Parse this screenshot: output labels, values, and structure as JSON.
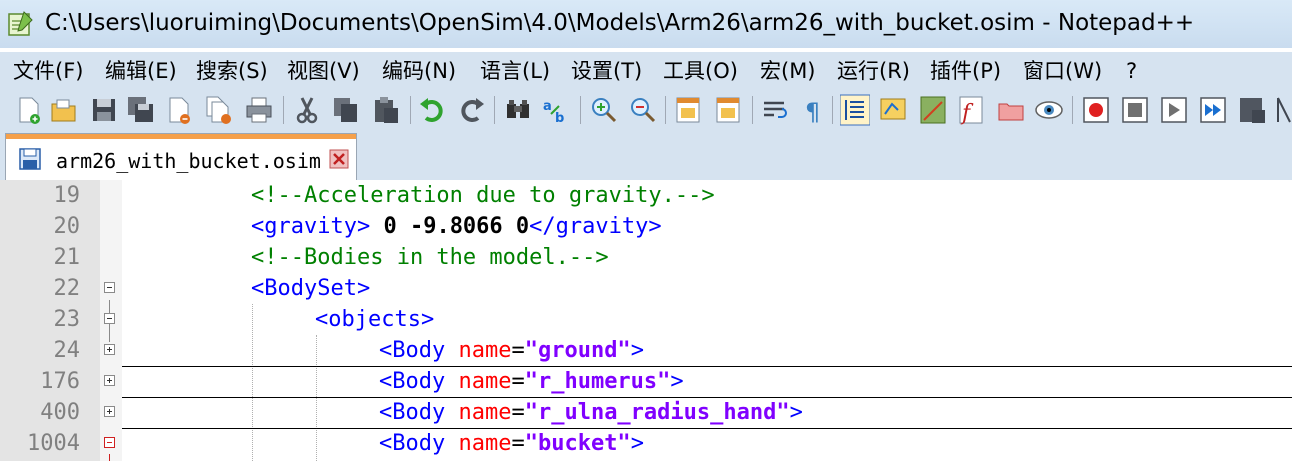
{
  "window": {
    "title": "C:\\Users\\luoruiming\\Documents\\OpenSim\\4.0\\Models\\Arm26\\arm26_with_bucket.osim - Notepad++"
  },
  "menu": [
    "文件(F)",
    "编辑(E)",
    "搜索(S)",
    "视图(V)",
    "编码(N)",
    "语言(L)",
    "设置(T)",
    "工具(O)",
    "宏(M)",
    "运行(R)",
    "插件(P)",
    "窗口(W)",
    "?"
  ],
  "toolbar": {
    "buttons": [
      "new-file-icon",
      "open-file-icon",
      "save-icon",
      "save-all-icon",
      "close-icon",
      "close-all-icon",
      "print-icon",
      "cut-icon",
      "copy-icon",
      "paste-icon",
      "undo-icon",
      "redo-icon",
      "find-icon",
      "replace-icon",
      "zoom-in-icon",
      "zoom-out-icon",
      "sync-vertical-icon",
      "sync-horizontal-icon",
      "word-wrap-icon",
      "show-all-characters-icon",
      "indent-guide-icon",
      "language-icon",
      "document-map-icon",
      "function-list-icon",
      "folder-as-workspace-icon",
      "monitoring-icon",
      "record-macro-icon",
      "stop-recording-icon",
      "play-macro-icon",
      "run-macro-multiple-icon",
      "save-macro-icon",
      "more-icon"
    ]
  },
  "tabs": [
    {
      "label": "arm26_with_bucket.osim"
    }
  ],
  "editor": {
    "lines": [
      {
        "num": "19",
        "fold": "",
        "indent": 8,
        "comment": "<!--Acceleration due to gravity.-->"
      },
      {
        "num": "20",
        "fold": "",
        "indent": 8,
        "tag_open": "<gravity>",
        "value": " 0 -9.8066 0",
        "tag_close": "</gravity>"
      },
      {
        "num": "21",
        "fold": "",
        "indent": 8,
        "comment": "<!--Bodies in the model.-->"
      },
      {
        "num": "22",
        "fold": "minus",
        "indent": 8,
        "tag_open": "<BodySet>"
      },
      {
        "num": "23",
        "fold": "minus",
        "indent": 12,
        "tag_open": "<objects>"
      },
      {
        "num": "24",
        "fold": "plus",
        "indent": 16,
        "tag_start": "<Body ",
        "attr": "name",
        "eq": "=",
        "val": "\"ground\"",
        "tag_end": ">"
      },
      {
        "num": "176",
        "fold": "plus",
        "indent": 16,
        "tag_start": "<Body ",
        "attr": "name",
        "eq": "=",
        "val": "\"r_humerus\"",
        "tag_end": ">"
      },
      {
        "num": "400",
        "fold": "plus",
        "indent": 16,
        "tag_start": "<Body ",
        "attr": "name",
        "eq": "=",
        "val": "\"r_ulna_radius_hand\"",
        "tag_end": ">"
      },
      {
        "num": "1004",
        "fold": "minus-red",
        "indent": 16,
        "tag_start": "<Body ",
        "attr": "name",
        "eq": "=",
        "val": "\"bucket\"",
        "tag_end": ">"
      }
    ]
  },
  "colors": {
    "comment": "#008000",
    "tag": "#0000ff",
    "attribute": "#ff0000",
    "attribute_value": "#8000ff",
    "tab_accent": "#f5a04a",
    "chrome": "#d6e3f0"
  }
}
